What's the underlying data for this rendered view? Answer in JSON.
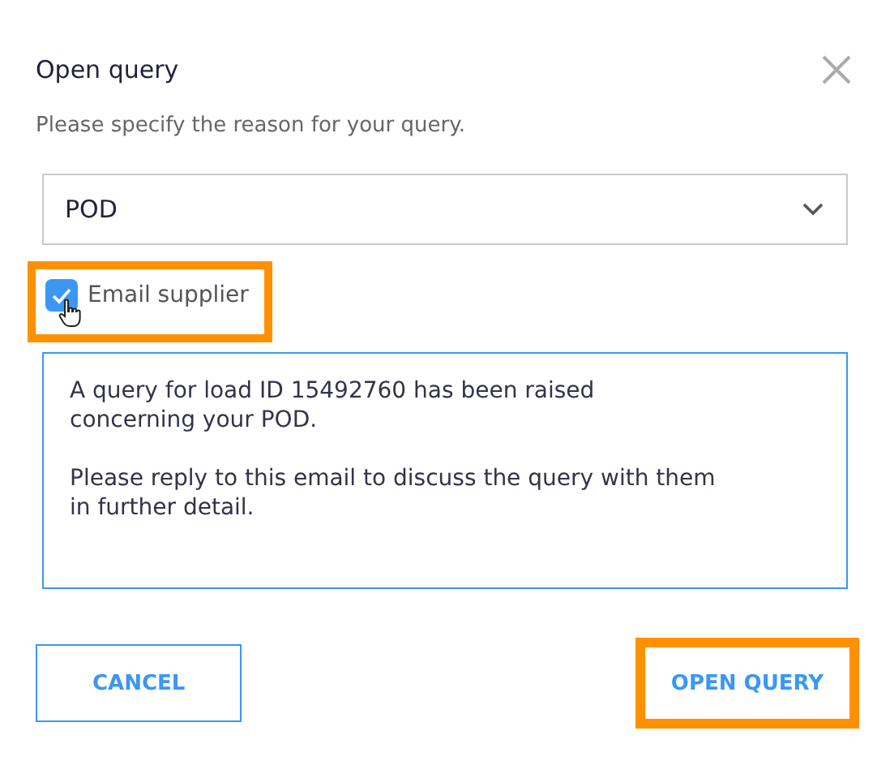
{
  "dialog": {
    "title": "Open query",
    "subtitle": "Please specify the reason for your query."
  },
  "reason_select": {
    "value": "POD"
  },
  "email_supplier": {
    "label": "Email supplier",
    "checked": true,
    "highlighted": true
  },
  "message": {
    "value": "A query for load ID 15492760 has been raised\nconcerning your POD.\n\nPlease reply to this email to discuss the query with them\nin further detail."
  },
  "buttons": [
    {
      "label": "CANCEL",
      "kind": "secondary",
      "highlighted": false
    },
    {
      "label": "OPEN QUERY",
      "kind": "primary",
      "highlighted": true
    }
  ]
}
